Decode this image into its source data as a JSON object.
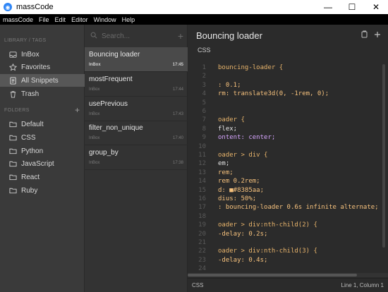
{
  "window": {
    "title": "massCode",
    "controls": [
      "minimize",
      "maximize",
      "close"
    ]
  },
  "menu": [
    "massCode",
    "File",
    "Edit",
    "Editor",
    "Window",
    "Help"
  ],
  "sidebar": {
    "library_title": "LIBRARY / TAGS",
    "library_items": [
      {
        "label": "InBox",
        "icon": "inbox-icon"
      },
      {
        "label": "Favorites",
        "icon": "star-icon"
      },
      {
        "label": "All Snippets",
        "icon": "snippets-icon"
      },
      {
        "label": "Trash",
        "icon": "trash-icon"
      }
    ],
    "folders_title": "FOLDERS",
    "folders": [
      {
        "label": "Default"
      },
      {
        "label": "CSS"
      },
      {
        "label": "Python"
      },
      {
        "label": "JavaScript"
      },
      {
        "label": "React"
      },
      {
        "label": "Ruby"
      }
    ],
    "add_folder": "+"
  },
  "snippets": {
    "search_placeholder": "Search...",
    "add": "+",
    "items": [
      {
        "name": "Bouncing loader",
        "folder": "InBox",
        "time": "17:45"
      },
      {
        "name": "mostFrequent",
        "folder": "InBox",
        "time": "17:44"
      },
      {
        "name": "usePrevious",
        "folder": "InBox",
        "time": "17:43"
      },
      {
        "name": "filter_non_unique",
        "folder": "InBox",
        "time": "17:40"
      },
      {
        "name": "group_by",
        "folder": "InBox",
        "time": "17:38"
      }
    ]
  },
  "editor": {
    "title": "Bouncing loader",
    "language": "CSS",
    "lines": [
      {
        "n": "1",
        "text": "bouncing-loader {"
      },
      {
        "n": "2",
        "text": ""
      },
      {
        "n": "3",
        "text": ": 0.1;"
      },
      {
        "n": "4",
        "text": "rm: translate3d(0, -1rem, 0);"
      },
      {
        "n": "5",
        "text": ""
      },
      {
        "n": "6",
        "text": ""
      },
      {
        "n": "7",
        "text": "oader {"
      },
      {
        "n": "8",
        "text": "flex;"
      },
      {
        "n": "9",
        "text": "ontent: center;"
      },
      {
        "n": "10",
        "text": ""
      },
      {
        "n": "11",
        "text": "oader > div {"
      },
      {
        "n": "12",
        "text": "em;"
      },
      {
        "n": "13",
        "text": "rem;"
      },
      {
        "n": "14",
        "text": "rem 0.2rem;"
      },
      {
        "n": "15",
        "text": "d: ■#8385aa;"
      },
      {
        "n": "16",
        "text": "dius: 50%;"
      },
      {
        "n": "17",
        "text": ": bouncing-loader 0.6s infinite alternate;"
      },
      {
        "n": "18",
        "text": ""
      },
      {
        "n": "19",
        "text": "oader > div:nth-child(2) {"
      },
      {
        "n": "20",
        "text": "-delay: 0.2s;"
      },
      {
        "n": "21",
        "text": ""
      },
      {
        "n": "22",
        "text": "oader > div:nth-child(3) {"
      },
      {
        "n": "23",
        "text": "-delay: 0.4s;"
      },
      {
        "n": "24",
        "text": ""
      }
    ],
    "status_left": "CSS",
    "status_right": "Line 1, Column 1"
  },
  "colors": {
    "accent": "#2f86f6",
    "sidebar_bg": "#3a3a3a",
    "list_bg": "#333333",
    "editor_bg": "#2b2b2b"
  }
}
